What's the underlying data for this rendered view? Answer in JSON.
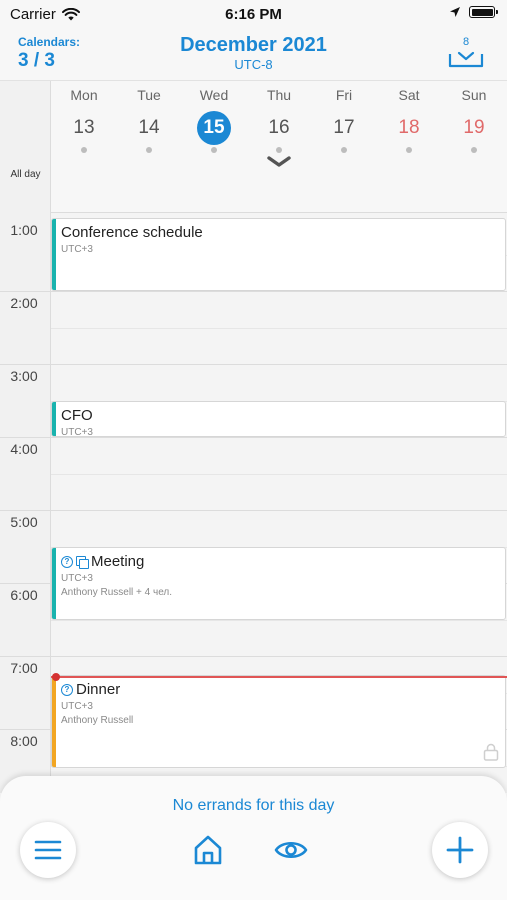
{
  "status_bar": {
    "carrier": "Carrier",
    "time": "6:16 PM"
  },
  "header": {
    "calendars_label": "Calendars:",
    "calendars_count": "3 / 3",
    "title": "December 2021",
    "timezone": "UTC-8",
    "inbox_count": "8"
  },
  "week": {
    "all_day_label": "All day",
    "days": [
      {
        "name": "Mon",
        "num": "13",
        "today": false,
        "weekend": false
      },
      {
        "name": "Tue",
        "num": "14",
        "today": false,
        "weekend": false
      },
      {
        "name": "Wed",
        "num": "15",
        "today": true,
        "weekend": false
      },
      {
        "name": "Thu",
        "num": "16",
        "today": false,
        "weekend": false
      },
      {
        "name": "Fri",
        "num": "17",
        "today": false,
        "weekend": false
      },
      {
        "name": "Sat",
        "num": "18",
        "today": false,
        "weekend": true
      },
      {
        "name": "Sun",
        "num": "19",
        "today": false,
        "weekend": true
      }
    ]
  },
  "hours": [
    "1:00",
    "2:00",
    "3:00",
    "4:00",
    "5:00",
    "6:00",
    "7:00",
    "8:00"
  ],
  "events": [
    {
      "title": "Conference schedule",
      "line1": "UTC+3",
      "line2": "",
      "color": "#19b3ae"
    },
    {
      "title": "CFO",
      "line1": "UTC+3",
      "line2": "",
      "color": "#19b3ae"
    },
    {
      "title": "Meeting",
      "line1": "UTC+3",
      "line2": "Anthony Russell + 4 чел.",
      "color": "#19b3ae"
    },
    {
      "title": "Dinner",
      "line1": "UTC+3",
      "line2": "Anthony Russell",
      "color": "#f2a623"
    }
  ],
  "bottom": {
    "message": "No errands for this day"
  },
  "colors": {
    "accent": "#1b88d4",
    "weekend": "#e06a6a",
    "now_line": "#e05555"
  },
  "icons": [
    "wifi-icon",
    "location-arrow-icon",
    "battery-icon",
    "inbox-download-icon",
    "chevron-down-icon",
    "help-circle-icon",
    "copy-icon",
    "lock-icon",
    "menu-icon",
    "home-icon",
    "eye-icon",
    "plus-icon"
  ]
}
